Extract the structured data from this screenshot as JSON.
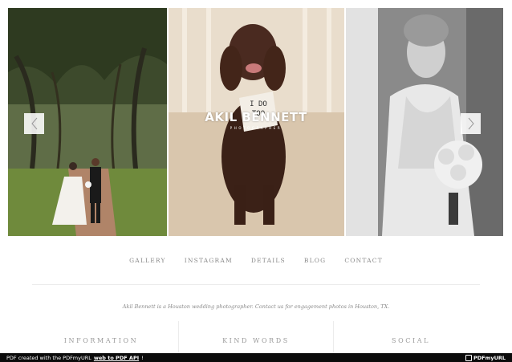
{
  "slider": {
    "slides": [
      {
        "name": "couple-under-oak-trees"
      },
      {
        "name": "poodle-with-sign",
        "sign_text": "I DO TOO"
      },
      {
        "name": "bride-with-bouquet"
      }
    ],
    "prev_icon": "chevron-left-icon",
    "next_icon": "chevron-right-icon"
  },
  "brand": {
    "name": "AKIL BENNETT",
    "subtitle": "PHOTOGRAPHER"
  },
  "nav": {
    "items": [
      "GALLERY",
      "INSTAGRAM",
      "DETAILS",
      "BLOG",
      "CONTACT"
    ]
  },
  "tagline": "Akil Bennett is a Houston wedding photographer. Contact us for engagement photos in Houston, TX.",
  "footer": {
    "columns": [
      "INFORMATION",
      "KIND WORDS",
      "SOCIAL"
    ]
  },
  "pdf_bar": {
    "prefix": "PDF created with the PDFmyURL",
    "link_text": "web to PDF API",
    "suffix": "!",
    "logo_text": "PDFmyURL"
  },
  "colors": {
    "text": "#8a8a8a",
    "bar_background": "#0b0b0b",
    "divider": "#ececec"
  }
}
